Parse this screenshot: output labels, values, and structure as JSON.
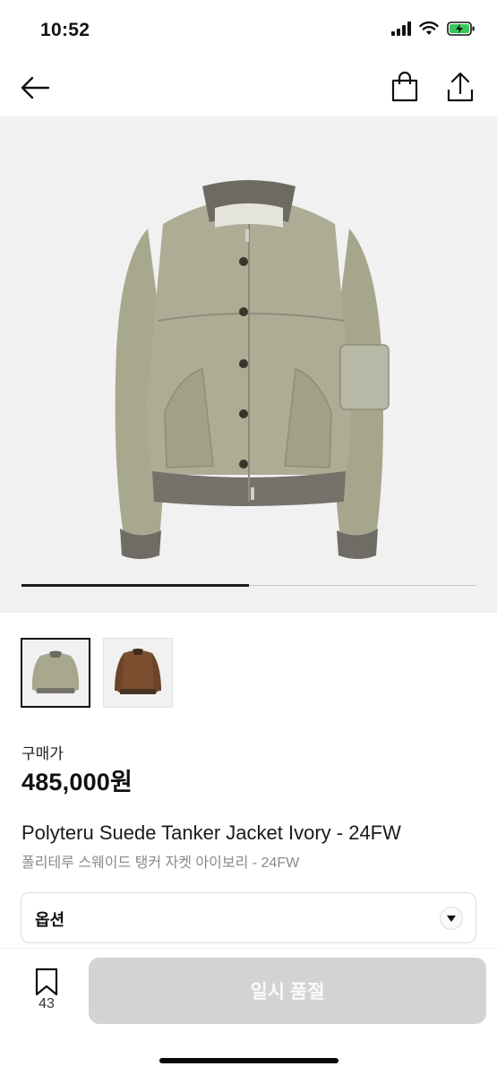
{
  "status_bar": {
    "time": "10:52",
    "battery_color": "#38c759"
  },
  "nav": {
    "back_icon": "arrow-left-icon",
    "bag_icon": "shopping-bag-icon",
    "share_icon": "share-icon"
  },
  "gallery": {
    "current_index": 1,
    "total": 2,
    "progress": 0.5,
    "thumbnail_colors": [
      "#a8a88f",
      "#7a4e2e"
    ]
  },
  "product": {
    "price_label": "구매가",
    "price": "485,000원",
    "title_en": "Polyteru Suede Tanker Jacket Ivory - 24FW",
    "title_ko": "폴리테루 스웨이드 탱커 자켓 아이보리 - 24FW"
  },
  "option": {
    "label": "옵션"
  },
  "bottom_bar": {
    "bookmark_count": "43",
    "cta_label": "일시 품절",
    "cta_color": "#d3d3d3"
  }
}
